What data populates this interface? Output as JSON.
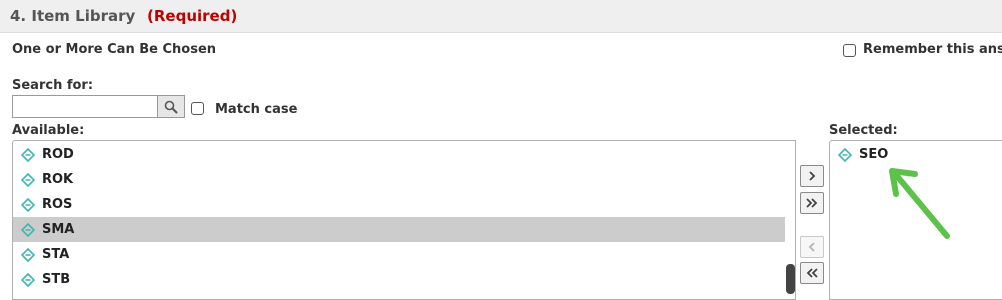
{
  "section": {
    "title": "4. Item Library",
    "required": "(Required)"
  },
  "choose_hint": "One or More Can Be Chosen",
  "remember": {
    "label": "Remember this ans",
    "checked": false
  },
  "search": {
    "label": "Search for:",
    "value": "",
    "placeholder": "",
    "match_case_label": "Match case",
    "match_case_checked": false
  },
  "available": {
    "label": "Available:",
    "items": [
      "ROD",
      "ROK",
      "ROS",
      "SMA",
      "STA",
      "STB"
    ],
    "highlighted": "SMA"
  },
  "selected": {
    "label": "Selected:",
    "items": [
      "SEO"
    ]
  },
  "buttons": {
    "add": "›",
    "add_all": "»",
    "remove": "‹",
    "remove_all": "«"
  },
  "colors": {
    "required": "#c00000",
    "item_icon": "#3fb6b2",
    "arrow_annotation": "#5cc24a",
    "highlight_row": "#cccccc"
  },
  "icons": {
    "item": "diamond-item-icon",
    "search": "magnifier-icon"
  }
}
